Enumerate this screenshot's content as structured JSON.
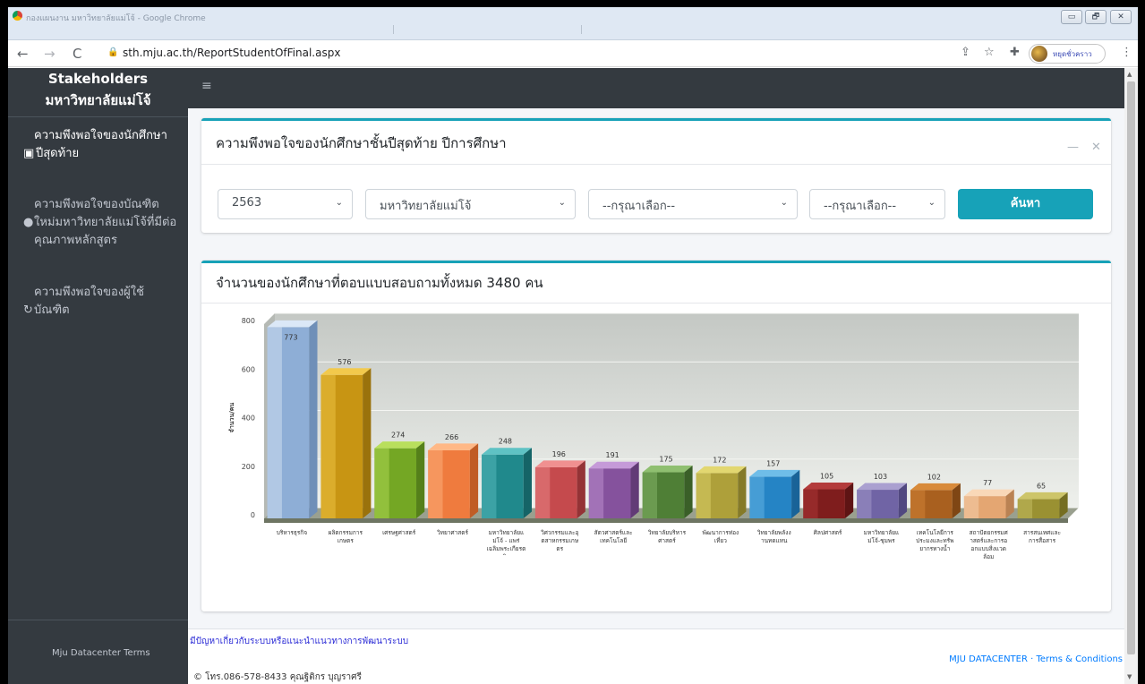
{
  "browser": {
    "window_title": "กองแผนงาน มหาวิทยาลัยแม่โจ้ - Google Chrome",
    "url": "sth.mju.ac.th/ReportStudentOfFinal.aspx",
    "profile_name": "หยุดชั่วคราว",
    "back": "←",
    "forward": "→",
    "reload": "C",
    "lock": "🔒",
    "share": "⇪",
    "star": "☆",
    "extensions": "✚",
    "menu": "⋮",
    "minimize": "▭",
    "maximize": "🗗",
    "close": "✕"
  },
  "sidebar": {
    "brand_line1": "Stakeholders",
    "brand_line2": "มหาวิทยาลัยแม่โจ้",
    "items": [
      {
        "icon": "▣",
        "line1": "ความพึงพอใจของนักศึกษา",
        "line2": "ปีสุดท้าย"
      },
      {
        "icon": "●",
        "line1": "ความพึงพอใจของบัณฑิต",
        "line2": "ใหม่มหาวิทยาลัยแม่โจ้ที่มีต่อ",
        "line3": "คุณภาพหลักสูตร"
      },
      {
        "icon": "↻",
        "line1": "ความพึงพอใจของผู้ใช้",
        "line2": "บัณฑิต"
      }
    ],
    "footer": "Mju Datacenter Terms"
  },
  "topnav": {
    "menu_icon": "≡"
  },
  "filter_card": {
    "title": "ความพึงพอใจของนักศึกษาชั้นปีสุดท้าย ปีการศึกษา",
    "minimize": "—",
    "close": "✕",
    "year": "2563",
    "university": "มหาวิทยาลัยแม่โจ้",
    "faculty": "--กรุณาเลือก--",
    "program": "--กรุณาเลือก--",
    "chevron": "⌄",
    "search_label": "ค้นหา"
  },
  "chart_card": {
    "title": "จำนวนของนักศึกษาที่ตอบแบบสอบถามทั้งหมด 3480 คน"
  },
  "chart_data": {
    "type": "bar",
    "ylabel": "จำนวน/คน",
    "ylim": [
      0,
      800
    ],
    "yticks": [
      0,
      200,
      400,
      600,
      800
    ],
    "grid": true,
    "categories": [
      [
        "บริหารธุรกิจ"
      ],
      [
        "ผลิตกรรมการ",
        "เกษตร"
      ],
      [
        "เศรษฐศาสตร์"
      ],
      [
        "วิทยาศาสตร์"
      ],
      [
        "มหาวิทยาลัยแ",
        "ม่โจ้ - แพร่",
        "เฉลิมพระเกียรต",
        "ิ"
      ],
      [
        "วิศวกรรมและอุ",
        "ตสาหกรรมเกษ",
        "ตร"
      ],
      [
        "สัตวศาสตร์และ",
        "เทคโนโลยี"
      ],
      [
        "วิทยาลัยบริหาร",
        "ศาสตร์"
      ],
      [
        "พัฒนาการท่อง",
        "เที่ยว"
      ],
      [
        "วิทยาลัยพลังง",
        "านทดแทน"
      ],
      [
        "ศิลปศาสตร์"
      ],
      [
        "มหาวิทยาลัยแ",
        "ม่โจ้-ชุมพร"
      ],
      [
        "เทคโนโลยีการ",
        "ประมงและทรัพ",
        "ยากรทางน้ำ"
      ],
      [
        "สถาปัตยกรรมศ",
        "าสตร์และการอ",
        "อกแบบสิ่งแวด",
        "ล้อม"
      ],
      [
        "สารสนเทศและ",
        "การสื่อสาร"
      ]
    ],
    "values": [
      773,
      576,
      274,
      266,
      248,
      196,
      191,
      175,
      172,
      157,
      105,
      103,
      102,
      77,
      65
    ],
    "colors": [
      [
        "#dbe8f7",
        "#8eaed6",
        "#6f8fb8"
      ],
      [
        "#f2c94c",
        "#c89513",
        "#9a720c"
      ],
      [
        "#b9df5c",
        "#74a724",
        "#55801a"
      ],
      [
        "#ffb886",
        "#ef7b3e",
        "#c05c25"
      ],
      [
        "#5fc2c4",
        "#20898c",
        "#156467"
      ],
      [
        "#f09090",
        "#c54a4d",
        "#943336"
      ],
      [
        "#c59ad8",
        "#85529d",
        "#623b76"
      ],
      [
        "#8fbf70",
        "#4f7f36",
        "#3a5f28"
      ],
      [
        "#e2d770",
        "#aea03a",
        "#857a28"
      ],
      [
        "#6fbde8",
        "#2584c5",
        "#196398"
      ],
      [
        "#b33b3b",
        "#7f1d1d",
        "#5e1414"
      ],
      [
        "#aaa0d0",
        "#7064a5",
        "#514880"
      ],
      [
        "#d88a3a",
        "#a9601f",
        "#7f4614"
      ],
      [
        "#f9d8b8",
        "#e4a672",
        "#ba8253"
      ],
      [
        "#cdc56a",
        "#9a9132",
        "#756e22"
      ]
    ]
  },
  "footer": {
    "help": "มีปัญหาเกี่ยวกับระบบหรือแนะนำแนวทางการพัฒนาระบบ",
    "contact": "© โทร.086-578-8433 คุณฐิติกร บุญราศรี",
    "links": "MJU DATACENTER · Terms & Conditions"
  },
  "scroll": {
    "up": "▲",
    "down": "▼"
  }
}
